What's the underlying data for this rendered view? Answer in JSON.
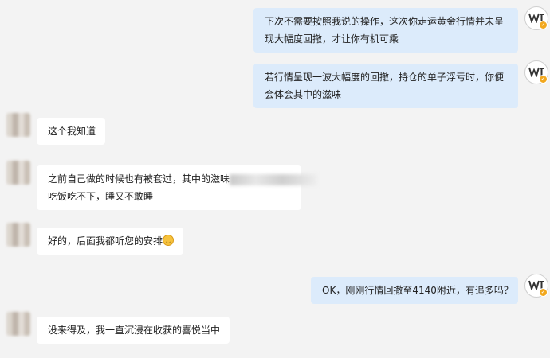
{
  "messages": [
    {
      "lines": [
        "下次不需要按照我说的操作，这次你走运黄金行情并未呈",
        "现大幅度回撤，才让你有机可乘"
      ]
    },
    {
      "lines": [
        "若行情呈现一波大幅度的回撤，持仓的单子浮亏时，你便",
        "会体会其中的滋味"
      ]
    },
    {
      "text": "这个我知道"
    },
    {
      "line1": "之前自己做的时候也有被套过，其中的滋味",
      "line2": "吃饭吃不下，睡又不敢睡"
    },
    {
      "text": "好的，后面我都听您的安排",
      "emoji": "grinning-face-icon"
    },
    {
      "text": "OK，刚刚行情回撤至4140附近，有追多吗？"
    },
    {
      "text": "没来得及，我一直沉浸在收获的喜悦当中"
    }
  ],
  "colors": {
    "background": "#f3f3f3",
    "outgoing_bubble": "#dcebfb",
    "incoming_bubble": "#ffffff",
    "verified_badge": "#f2a81e"
  }
}
